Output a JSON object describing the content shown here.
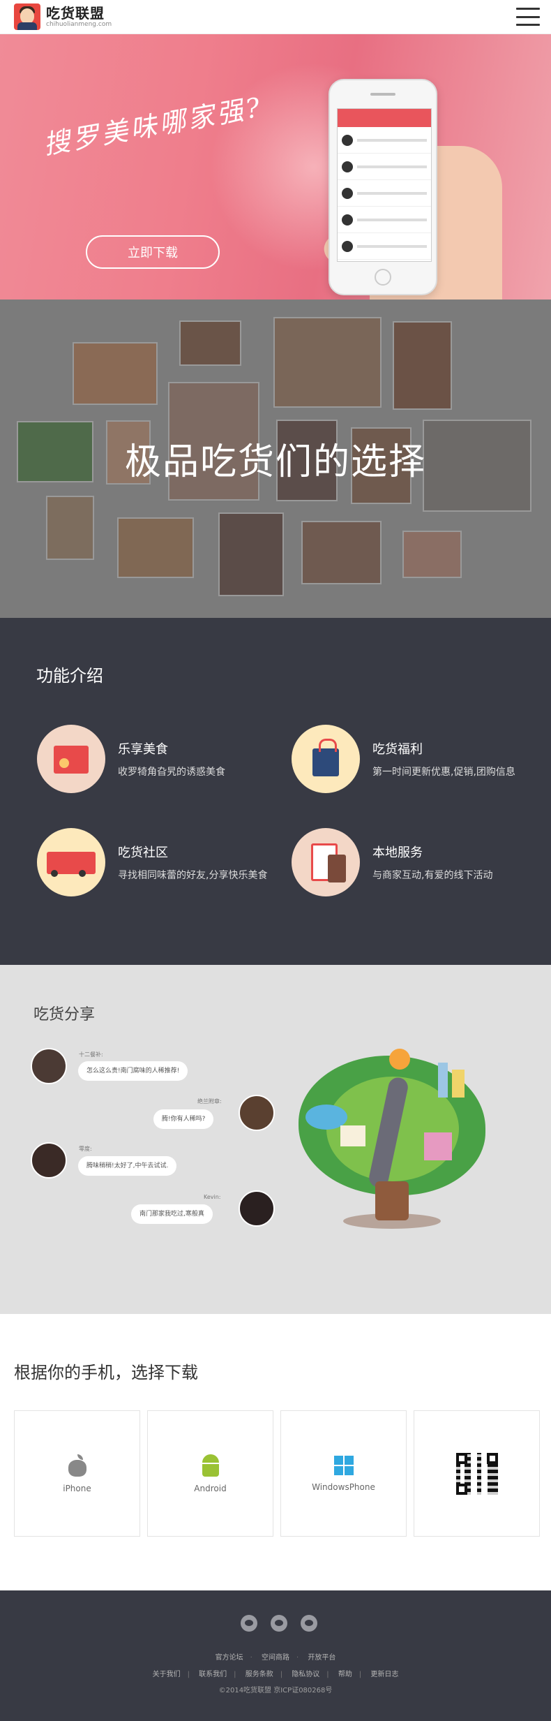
{
  "header": {
    "brand_name": "吃货联盟",
    "brand_domain": "chihuolianmeng.com"
  },
  "hero": {
    "slogan": "搜罗美味哪家强?",
    "download_button": "立即下载",
    "carousel": {
      "count": 4,
      "active_index": 0
    }
  },
  "collage": {
    "title": "极品吃货们的选择"
  },
  "features": {
    "title": "功能介绍",
    "items": [
      {
        "title": "乐享美食",
        "desc": "收罗犄角旮旯的诱惑美食",
        "icon": "shop-icon"
      },
      {
        "title": "吃货福利",
        "desc": "第一时间更新优惠,促销,团购信息",
        "icon": "gift-bag-icon"
      },
      {
        "title": "吃货社区",
        "desc": "寻找相同味蕾的好友,分享快乐美食",
        "icon": "truck-icon"
      },
      {
        "title": "本地服务",
        "desc": "与商家互动,有爱的线下活动",
        "icon": "checklist-icon"
      }
    ]
  },
  "share": {
    "title": "吃货分享",
    "messages": [
      {
        "user": "十二餐补:",
        "text": "怎么这么贵!南门腐味的人稀推荐!",
        "side": "left"
      },
      {
        "user": "绝兰附章:",
        "text": "腾!你有人稀吗?",
        "side": "right"
      },
      {
        "user": "零度:",
        "text": "腾味稍稍!太好了,中午去试试.",
        "side": "left"
      },
      {
        "user": "Kevin:",
        "text": "南门那家我吃过,寒般真",
        "side": "right"
      }
    ]
  },
  "download": {
    "title": "根据你的手机，选择下载",
    "options": [
      {
        "label": "iPhone",
        "icon": "apple-icon"
      },
      {
        "label": "Android",
        "icon": "android-icon"
      },
      {
        "label": "WindowsPhone",
        "icon": "windows-icon"
      },
      {
        "label": "",
        "icon": "qr-code-icon"
      }
    ]
  },
  "footer": {
    "social": [
      "weibo-icon",
      "wechat-icon",
      "qq-icon"
    ],
    "links_row1": [
      "官方论坛",
      "空间商路",
      "开放平台"
    ],
    "links_row2": [
      "关于我们",
      "联系我们",
      "服务条款",
      "隐私协议",
      "帮助",
      "更新日志"
    ],
    "copyright": "©2014吃货联盟 京ICP证080268号"
  },
  "colors": {
    "accent": "#e9555c",
    "dark_bg": "#383a44",
    "collage_bg": "#7b7b7b",
    "share_bg": "#e0e0e0"
  }
}
